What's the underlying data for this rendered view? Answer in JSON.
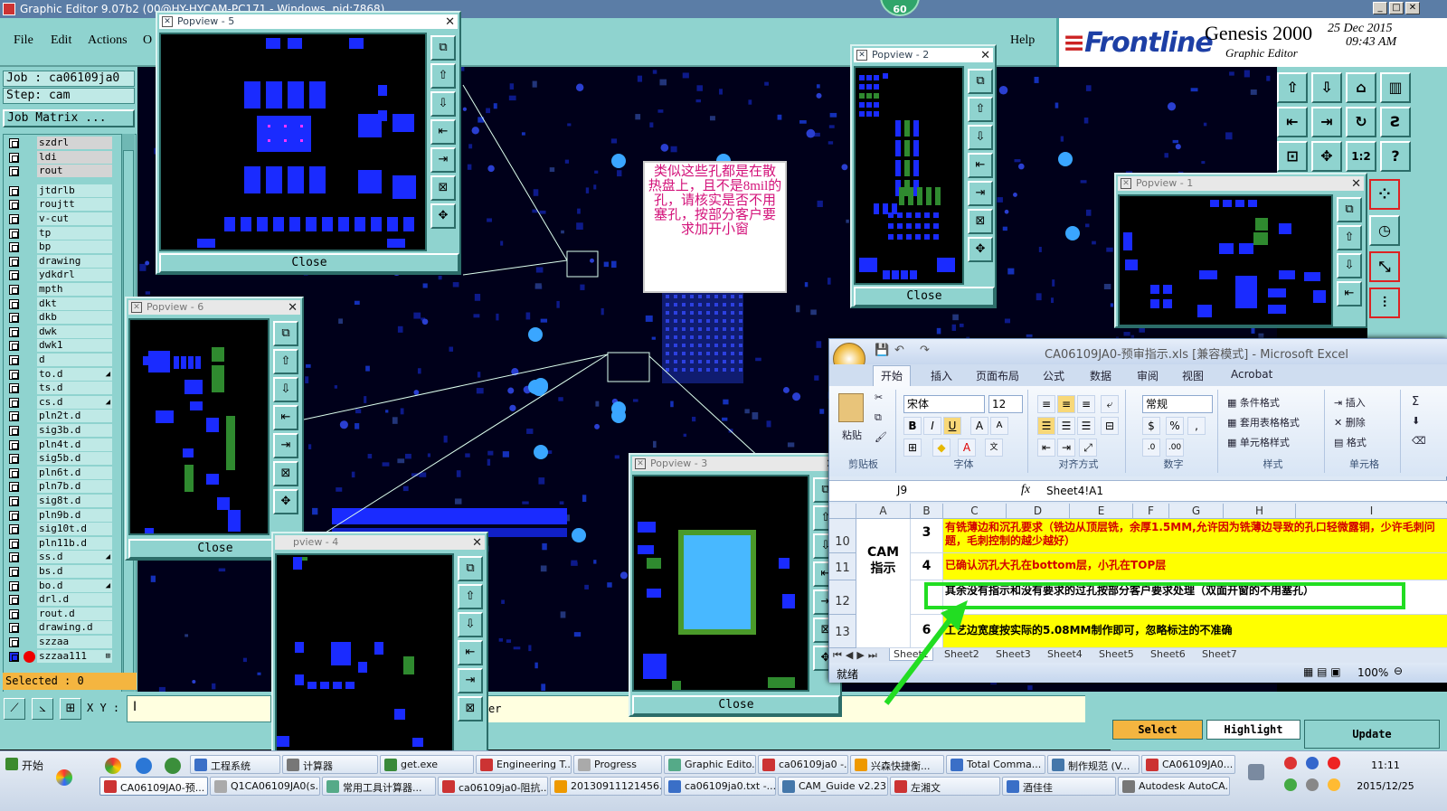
{
  "window": {
    "title": "Graphic Editor 9.07b2 (00@HY-HYCAM-PC171 - Windows, pid:7868)",
    "badge": "60"
  },
  "menu": {
    "file": "File",
    "edit": "Edit",
    "actions": "Actions",
    "options_partial": "O",
    "help": "Help"
  },
  "brand": {
    "logo": "Frontline",
    "product": "Genesis 2000",
    "module": "Graphic Editor",
    "date": "25 Dec 2015",
    "time": "09:43 AM"
  },
  "left": {
    "job": "Job : ca06109ja0",
    "step": "Step: cam",
    "job_matrix": "Job Matrix ...",
    "selected": "Selected : 0",
    "layers": [
      {
        "name": "szdrl",
        "selected": true,
        "mark": ""
      },
      {
        "name": "ldi",
        "selected": true,
        "mark": ""
      },
      {
        "name": "rout",
        "selected": true,
        "mark": ""
      },
      {
        "name": "jtdrlb",
        "selected": false,
        "mark": ""
      },
      {
        "name": "roujtt",
        "selected": false,
        "mark": ""
      },
      {
        "name": "v-cut",
        "selected": false,
        "mark": ""
      },
      {
        "name": "tp",
        "selected": false,
        "mark": ""
      },
      {
        "name": "bp",
        "selected": false,
        "mark": ""
      },
      {
        "name": "drawing",
        "selected": false,
        "mark": ""
      },
      {
        "name": "ydkdrl",
        "selected": false,
        "mark": ""
      },
      {
        "name": "mpth",
        "selected": false,
        "mark": ""
      },
      {
        "name": "dkt",
        "selected": false,
        "mark": ""
      },
      {
        "name": "dkb",
        "selected": false,
        "mark": ""
      },
      {
        "name": "dwk",
        "selected": false,
        "mark": ""
      },
      {
        "name": "dwk1",
        "selected": false,
        "mark": ""
      },
      {
        "name": "d",
        "selected": false,
        "mark": ""
      },
      {
        "name": "to.d",
        "selected": false,
        "mark": "◢"
      },
      {
        "name": "ts.d",
        "selected": false,
        "mark": ""
      },
      {
        "name": "cs.d",
        "selected": false,
        "mark": "◢"
      },
      {
        "name": "pln2t.d",
        "selected": false,
        "mark": ""
      },
      {
        "name": "sig3b.d",
        "selected": false,
        "mark": ""
      },
      {
        "name": "pln4t.d",
        "selected": false,
        "mark": ""
      },
      {
        "name": "sig5b.d",
        "selected": false,
        "mark": ""
      },
      {
        "name": "pln6t.d",
        "selected": false,
        "mark": ""
      },
      {
        "name": "pln7b.d",
        "selected": false,
        "mark": ""
      },
      {
        "name": "sig8t.d",
        "selected": false,
        "mark": ""
      },
      {
        "name": "pln9b.d",
        "selected": false,
        "mark": ""
      },
      {
        "name": "sig10t.d",
        "selected": false,
        "mark": ""
      },
      {
        "name": "pln11b.d",
        "selected": false,
        "mark": ""
      },
      {
        "name": "ss.d",
        "selected": false,
        "mark": "◢"
      },
      {
        "name": "bs.d",
        "selected": false,
        "mark": ""
      },
      {
        "name": "bo.d",
        "selected": false,
        "mark": "◢"
      },
      {
        "name": "drl.d",
        "selected": false,
        "mark": ""
      },
      {
        "name": "rout.d",
        "selected": false,
        "mark": ""
      },
      {
        "name": "drawing.d",
        "selected": false,
        "mark": ""
      },
      {
        "name": "szzaa",
        "selected": false,
        "mark": ""
      },
      {
        "name": "szzaa111",
        "selected": false,
        "mark": "⊞"
      }
    ]
  },
  "bottom": {
    "xy_label": "X Y :",
    "status_partial": "er"
  },
  "right_buttons": {
    "select": "Select",
    "highlight": "Highlight",
    "update": "Update"
  },
  "popviews": {
    "p5": {
      "title": "Popview - 5",
      "close": "Close"
    },
    "p2": {
      "title": "Popview - 2",
      "close": "Close"
    },
    "p1": {
      "title": "Popview - 1"
    },
    "p6": {
      "title": "Popview - 6",
      "close": "Close"
    },
    "p4": {
      "title": "pview - 4"
    },
    "p3": {
      "title": "Popview - 3",
      "close": "Close"
    }
  },
  "note": "类似这些孔都是在散热盘上，且不是8mil的孔，请核实是否不用塞孔，按部分客户要求加开小窗",
  "excel": {
    "title": "CA06109JA0-预审指示.xls  [兼容模式] - Microsoft Excel",
    "tabs": [
      "开始",
      "插入",
      "页面布局",
      "公式",
      "数据",
      "审阅",
      "视图",
      "Acrobat"
    ],
    "clipboard": {
      "paste": "粘贴",
      "label": "剪贴板"
    },
    "font": {
      "name": "宋体",
      "size": "12",
      "label": "字体"
    },
    "align_label": "对齐方式",
    "number": {
      "format": "常规",
      "label": "数字"
    },
    "styles": {
      "cond": "条件格式",
      "table": "套用表格格式",
      "cell": "单元格样式",
      "label": "样式"
    },
    "cells": {
      "insert": "插入",
      "delete": "删除",
      "format": "格式",
      "label": "单元格"
    },
    "namebox": "J9",
    "formula": "Sheet4!A1",
    "columns": [
      "A",
      "B",
      "C",
      "D",
      "E",
      "F",
      "G",
      "H",
      "I"
    ],
    "row_numbers": [
      "10",
      "11",
      "12",
      "13"
    ],
    "merged_label": "CAM\n指示",
    "rows": [
      {
        "num": "3",
        "text": "有铣薄边和沉孔要求（铣边从顶层铣，余厚1.5MM,允许因为铣薄边导致的孔口轻微露铜，少许毛刺问题，毛刺控制的越少越好）"
      },
      {
        "num": "4",
        "text": "已确认沉孔大孔在bottom层，小孔在TOP层"
      },
      {
        "num": "",
        "text": "其余没有指示和没有要求的过孔按部分客户要求处理（双面开窗的不用塞孔）"
      },
      {
        "num": "6",
        "text": "工艺边宽度按实际的5.08MM制作即可，忽略标注的不准确"
      }
    ],
    "sheets": [
      "Sheet1",
      "Sheet2",
      "Sheet3",
      "Sheet4",
      "Sheet5",
      "Sheet6",
      "Sheet7"
    ],
    "status": "就绪",
    "zoom": "100%"
  },
  "taskbar": {
    "start": "开始",
    "row1": [
      "工程系统",
      "计算器",
      "get.exe",
      "Engineering T...",
      "Progress",
      "Graphic Edito...",
      "ca06109ja0 -...",
      "兴森快捷衡...",
      "Total Comma...",
      "制作规范 (V...",
      "CA06109JA0..."
    ],
    "row2": [
      "CA06109JA0-预...",
      "Q1CA06109JA0(s...",
      "常用工具计算器...",
      "ca06109ja0-阻抗...",
      "20130911121456...",
      "ca06109ja0.txt -...",
      "CAM_Guide v2.23",
      "左湘文",
      "酒佳佳",
      "Autodesk AutoCA..."
    ],
    "time": "11:11",
    "date": "2015/12/25"
  },
  "colors": {
    "cam_panel": "#8fd3cf",
    "pad_blue": "#1a2bff",
    "pad_green": "#2f8a2f",
    "note_text": "#d3127a",
    "highlight_yellow": "#ffff00",
    "excel_red_text": "#d40000",
    "callout_green": "#22dd22"
  }
}
